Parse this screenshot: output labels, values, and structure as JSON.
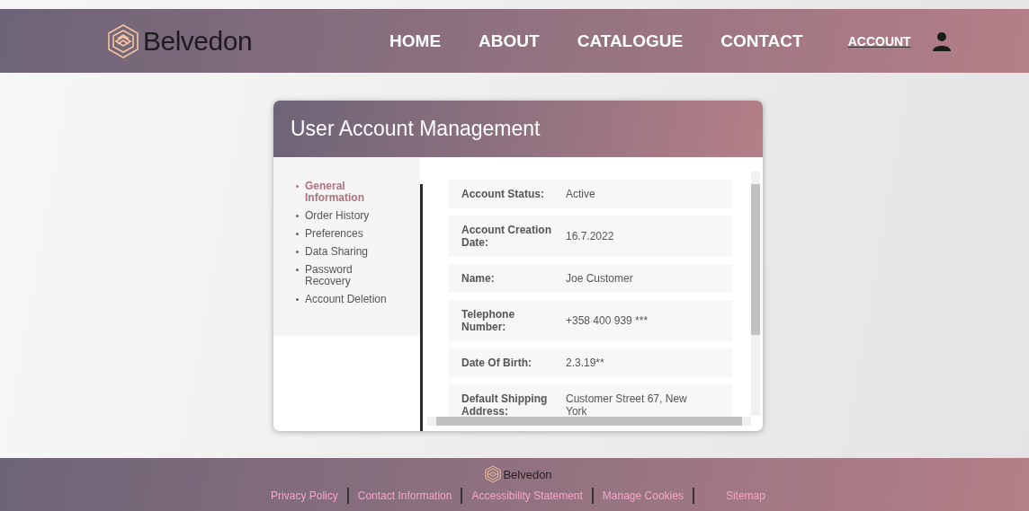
{
  "header": {
    "brand": "Belvedon",
    "nav": [
      {
        "label": "HOME",
        "selected": false
      },
      {
        "label": "ABOUT",
        "selected": false
      },
      {
        "label": "CATALOGUE",
        "selected": false
      },
      {
        "label": "CONTACT",
        "selected": false
      }
    ],
    "account": "ACCOUNT"
  },
  "card": {
    "title": "User Account Management",
    "sidebar": [
      {
        "label": "General Information",
        "selected": true
      },
      {
        "label": "Order History",
        "selected": false
      },
      {
        "label": "Preferences",
        "selected": false
      },
      {
        "label": "Data Sharing",
        "selected": false
      },
      {
        "label": "Password Recovery",
        "selected": false
      },
      {
        "label": "Account Deletion",
        "selected": false
      }
    ],
    "fields": [
      {
        "label": "Account Status:",
        "value": "Active"
      },
      {
        "label": "Account Creation Date:",
        "value": "16.7.2022"
      },
      {
        "label": "Name:",
        "value": "Joe Customer"
      },
      {
        "label": "Telephone Number:",
        "value": "+358 400 939 ***"
      },
      {
        "label": "Date Of Birth:",
        "value": "2.3.19**"
      },
      {
        "label": "Default Shipping Address:",
        "value": "Customer Street 67, New York"
      }
    ]
  },
  "footer": {
    "brand": "Belvedon",
    "links": [
      "Privacy Policy",
      "Contact Information",
      "Accessibility Statement",
      "Manage Cookies",
      "Sitemap"
    ]
  }
}
